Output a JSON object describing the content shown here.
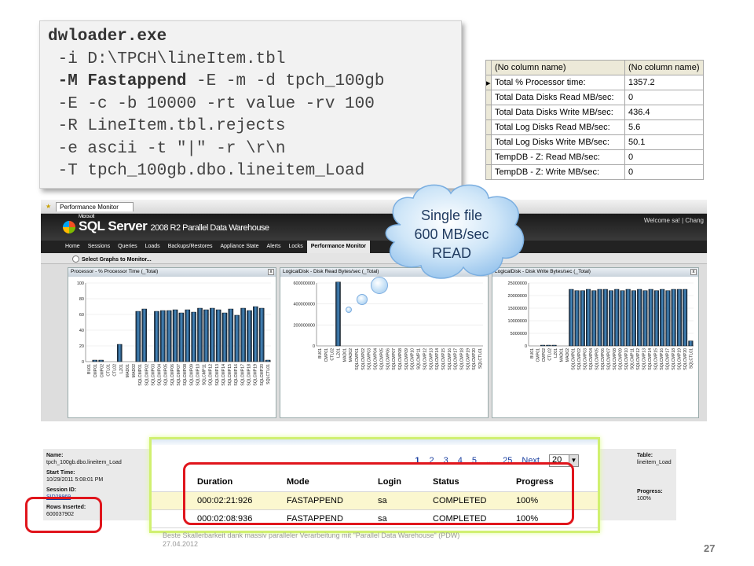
{
  "command": {
    "lines": [
      {
        "text": "dwloader.exe",
        "bold": true
      },
      {
        "text": " -i D:\\TPCH\\lineItem.tbl",
        "bold": false
      },
      {
        "prefix": " ",
        "bold_part": "-M Fastappend",
        "rest": " -E -m -d tpch_100gb"
      },
      {
        "text": " -E -c -b 10000 -rt value -rv 100",
        "bold": false
      },
      {
        "text": " -R LineItem.tbl.rejects",
        "bold": false
      },
      {
        "text": " -e ascii -t \"|\" -r \\r\\n",
        "bold": false
      },
      {
        "text": " -T tpch_100gb.dbo.lineitem_Load",
        "bold": false
      }
    ]
  },
  "counters": {
    "headers": [
      "(No column name)",
      "(No column name)"
    ],
    "rows": [
      [
        "Total % Processor time:",
        "1357.2"
      ],
      [
        "Total Data Disks Read MB/sec:",
        "0"
      ],
      [
        "Total Data Disks Write MB/sec:",
        "436.4"
      ],
      [
        "Total Log Disks Read MB/sec:",
        "5.6"
      ],
      [
        "Total Log Disks Write MB/sec:",
        "50.1"
      ],
      [
        "TempDB - Z: Read MB/sec:",
        "0"
      ],
      [
        "TempDB - Z: Write MB/sec:",
        "0"
      ]
    ]
  },
  "pdw": {
    "tab_label": "Performance Monitor",
    "logo_small": "Microsoft",
    "logo_main": "SQL Server",
    "logo_sub": "2008 R2 Parallel Data Warehouse",
    "welcome": "Welcome sa! | Chang",
    "nav": [
      "Home",
      "Sessions",
      "Queries",
      "Loads",
      "Backups/Restores",
      "Appliance State",
      "Alerts",
      "Locks",
      "Performance Monitor"
    ],
    "toolbar": "Select Graphs to Monitor...",
    "close_glyph": "x"
  },
  "chart_data": [
    {
      "type": "bar",
      "title": "Processor - % Processor Time (_Total)",
      "ylim": [
        0,
        100
      ],
      "yticks": [
        "100",
        "80",
        "60",
        "40",
        "20",
        "0"
      ],
      "categories": [
        "BU01",
        "CMP01",
        "CMP02",
        "CTL01",
        "CTL02",
        "LZ01",
        "MAD01",
        "MAD02",
        "SQLCMP01",
        "SQLCMP02",
        "SQLCMP03",
        "SQLCMP04",
        "SQLCMP05",
        "SQLCMP06",
        "SQLCMP07",
        "SQLCMP08",
        "SQLCMP09",
        "SQLCMP10",
        "SQLCMP11",
        "SQLCMP12",
        "SQLCMP13",
        "SQLCMP14",
        "SQLCMP15",
        "SQLCMP16",
        "SQLCMP17",
        "SQLCMP18",
        "SQLCMP19",
        "SQLCMP20",
        "SQLCTL01"
      ],
      "values": [
        0,
        2,
        2,
        0,
        0,
        22,
        0,
        0,
        64,
        67,
        0,
        64,
        65,
        65,
        66,
        62,
        66,
        63,
        68,
        66,
        68,
        66,
        62,
        67,
        59,
        68,
        65,
        70,
        68,
        2
      ]
    },
    {
      "type": "bar",
      "title": "LogicalDisk - Disk Read Bytes/sec (_Total)",
      "ylim": [
        0,
        600000000
      ],
      "yticks": [
        "600000000",
        "400000000",
        "200000000",
        "0"
      ],
      "categories": [
        "BU01",
        "CMP01",
        "CTL02",
        "LZ01",
        "MAD01",
        "MAD02",
        "SQLCMP01",
        "SQLCMP02",
        "SQLCMP03",
        "SQLCMP04",
        "SQLCMP05",
        "SQLCMP06",
        "SQLCMP07",
        "SQLCMP08",
        "SQLCMP09",
        "SQLCMP10",
        "SQLCMP11",
        "SQLCMP12",
        "SQLCMP13",
        "SQLCMP14",
        "SQLCMP15",
        "SQLCMP16",
        "SQLCMP17",
        "SQLCMP18",
        "SQLCMP19",
        "SQLCMP20",
        "SQLCTL01"
      ],
      "values": [
        0,
        0,
        0,
        610000000,
        0,
        0,
        0,
        0,
        0,
        0,
        0,
        0,
        0,
        0,
        0,
        0,
        0,
        0,
        0,
        0,
        0,
        0,
        0,
        0,
        0,
        0,
        0
      ]
    },
    {
      "type": "bar",
      "title": "LogicalDisk - Disk Write Bytes/sec (_Total)",
      "ylim": [
        0,
        25000000
      ],
      "yticks": [
        "25000000",
        "20000000",
        "15000000",
        "10000000",
        "5000000",
        "0"
      ],
      "categories": [
        "BU01",
        "CMP01",
        "CMP02",
        "CTL02",
        "LZ01",
        "MAD01",
        "MAD02",
        "SQLCMP01",
        "SQLCMP02",
        "SQLCMP03",
        "SQLCMP04",
        "SQLCMP05",
        "SQLCMP06",
        "SQLCMP07",
        "SQLCMP08",
        "SQLCMP09",
        "SQLCMP10",
        "SQLCMP11",
        "SQLCMP12",
        "SQLCMP13",
        "SQLCMP14",
        "SQLCMP15",
        "SQLCMP16",
        "SQLCMP17",
        "SQLCMP18",
        "SQLCMP19",
        "SQLCMP20",
        "SQLCTL01"
      ],
      "values": [
        0,
        0,
        300000,
        300000,
        300000,
        0,
        0,
        22500000,
        22000000,
        22000000,
        22500000,
        22000000,
        22500000,
        22500000,
        22000000,
        22500000,
        22000000,
        22500000,
        22000000,
        22500000,
        22000000,
        22500000,
        22000000,
        22500000,
        22000000,
        22500000,
        22500000,
        22500000,
        2000000
      ]
    }
  ],
  "cloud": {
    "lines": [
      "Single file",
      "600 MB/sec",
      "READ"
    ]
  },
  "session": {
    "name_label": "Name:",
    "name_value": "tpch_100gb.dbo.lineitem_Load",
    "start_label": "Start Time:",
    "start_value": "10/29/2011 5:08:01 PM",
    "sid_label": "Session ID:",
    "sid_value": "SID29969",
    "rows_label": "Rows Inserted:",
    "rows_value": "600037902",
    "table_label": "Table:",
    "table_value": "lineitem_Load",
    "progress_label": "Progress:",
    "progress_value": "100%"
  },
  "results": {
    "pager": {
      "pages": [
        "1",
        "2",
        "3",
        "4",
        "5",
        "...",
        "25"
      ],
      "next": "Next",
      "page_size": "20",
      "arrow": "▼"
    },
    "headers": [
      "Duration",
      "Mode",
      "Login",
      "Status",
      "Progress"
    ],
    "rows": [
      [
        "000:02:21:926",
        "FASTAPPEND",
        "sa",
        "COMPLETED",
        "100%"
      ],
      [
        "000:02:08:936",
        "FASTAPPEND",
        "sa",
        "COMPLETED",
        "100%"
      ]
    ]
  },
  "footer": {
    "line1": "Beste Skallerbarkeit dank massiv paralleler Verarbeitung mit \"Parallel Data Warehouse\" (PDW)",
    "line2": "27.04.2012",
    "page": "27"
  }
}
